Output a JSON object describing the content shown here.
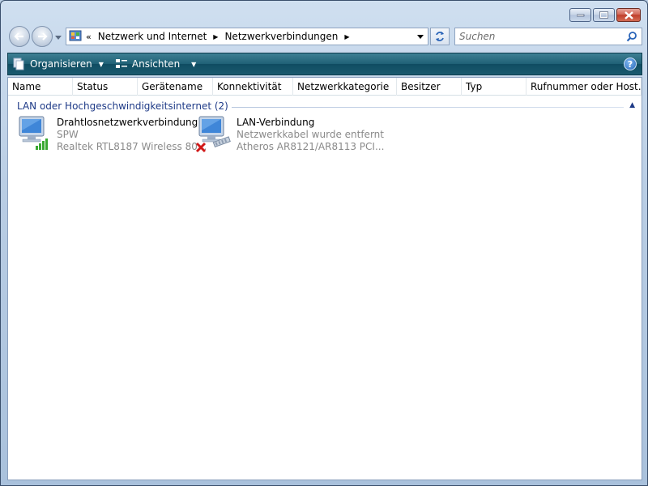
{
  "address": {
    "overflow": "«",
    "segments": [
      "Netzwerk und Internet",
      "Netzwerkverbindungen"
    ]
  },
  "search": {
    "placeholder": "Suchen"
  },
  "toolbar": {
    "organize_label": "Organisieren",
    "views_label": "Ansichten",
    "help_label": "?"
  },
  "columns": [
    "Name",
    "Status",
    "Gerätename",
    "Konnektivität",
    "Netzwerkkategorie",
    "Besitzer",
    "Typ",
    "Rufnummer oder Host..."
  ],
  "group": {
    "title": "LAN oder Hochgeschwindigkeitsinternet (2)"
  },
  "connections": [
    {
      "name": "Drahtlosnetzwerkverbindung",
      "status": "SPW",
      "device": "Realtek RTL8187 Wireless 80...",
      "icon": "wireless-connection-icon"
    },
    {
      "name": "LAN-Verbindung",
      "status": "Netzwerkkabel wurde entfernt",
      "device": "Atheros AR8121/AR8113 PCI...",
      "icon": "lan-connection-disconnected-icon"
    }
  ],
  "colors": {
    "toolbar": "#1f6176",
    "group_title": "#1e3a87",
    "secondary_text": "#8a8a8a",
    "error_x": "#d01818",
    "signal_green": "#3aa832"
  }
}
